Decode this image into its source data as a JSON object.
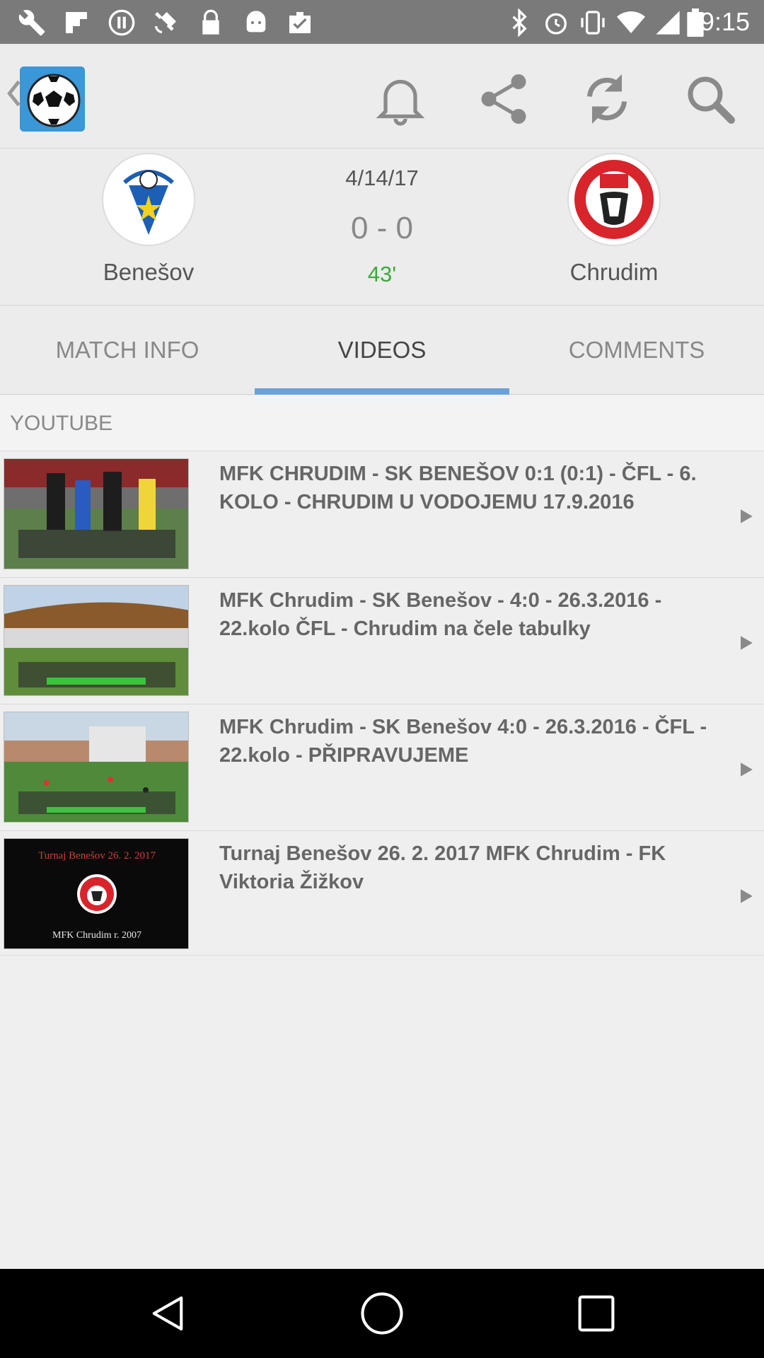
{
  "status_bar": {
    "time": "9:15",
    "left_icons": [
      "wrench-icon",
      "flipboard-icon",
      "media-pause-icon",
      "satellite-icon",
      "lock-icon",
      "android-icon",
      "clipboard-check-icon"
    ],
    "right_icons": [
      "bluetooth-icon",
      "alarm-icon",
      "vibrate-icon",
      "wifi-icon",
      "signal-icon",
      "battery-icon"
    ]
  },
  "app_bar": {
    "icons": [
      "back-chevron-icon",
      "soccer-ball-icon",
      "bell-icon",
      "share-icon",
      "refresh-icon",
      "search-icon"
    ]
  },
  "match": {
    "home_team": "Benešov",
    "away_team": "Chrudim",
    "date": "4/14/17",
    "score": "0 - 0",
    "minute": "43'",
    "minute_color": "#3caa3c"
  },
  "tabs": [
    {
      "label": "MATCH INFO",
      "active": false
    },
    {
      "label": "VIDEOS",
      "active": true
    },
    {
      "label": "COMMENTS",
      "active": false
    }
  ],
  "accent_color": "#6aa2d8",
  "section": {
    "title": "YOUTUBE"
  },
  "videos": [
    {
      "title": "MFK CHRUDIM - SK BENEŠOV 0:1 (0:1) - ČFL - 6. KOLO - CHRUDIM U VODOJEMU 17.9.2016"
    },
    {
      "title": "MFK Chrudim -  SK Benešov - 4:0 - 26.3.2016 - 22.kolo ČFL - Chrudim na čele tabulky"
    },
    {
      "title": "MFK Chrudim - SK Benešov  4:0 - 26.3.2016 - ČFL - 22.kolo - PŘIPRAVUJEME"
    },
    {
      "title": "Turnaj Benešov 26. 2. 2017 MFK Chrudim - FK Viktoria Žižkov",
      "thumb_caption_1": "Turnaj Benešov 26. 2. 2017",
      "thumb_caption_2": "MFK Chrudim r. 2007"
    }
  ],
  "nav_bar": {
    "icons": [
      "back-icon",
      "home-icon",
      "recents-icon"
    ]
  }
}
